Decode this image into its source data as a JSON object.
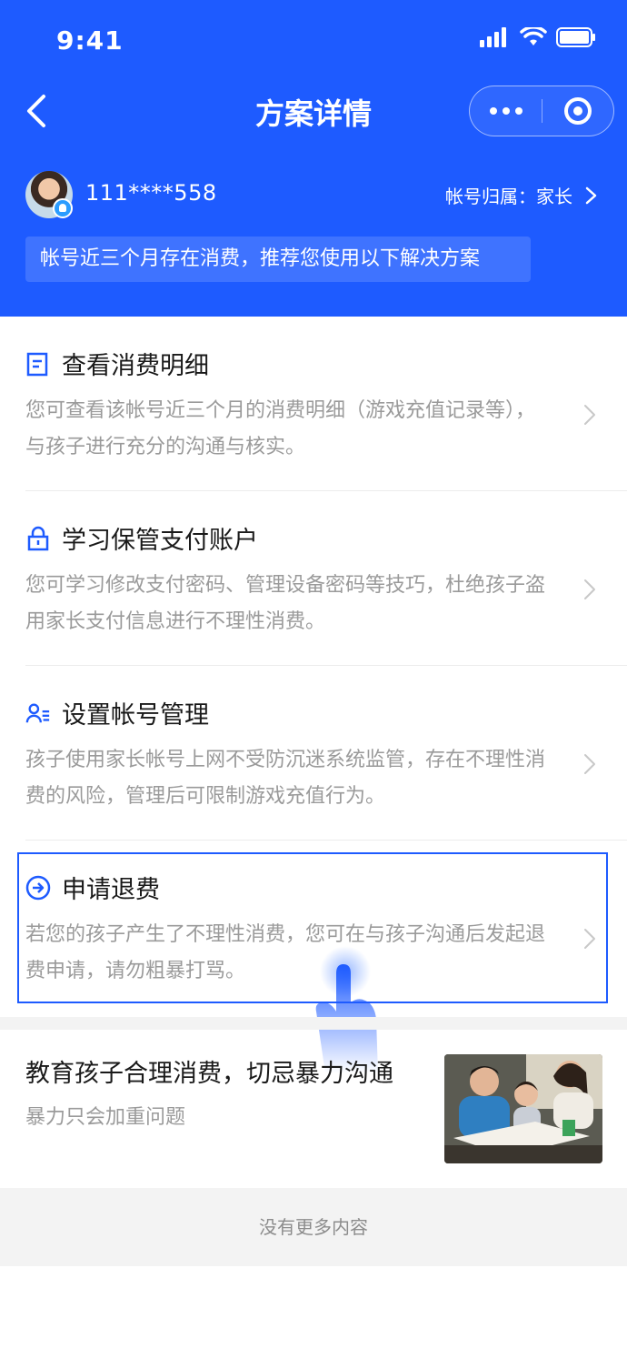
{
  "status": {
    "time": "9:41"
  },
  "nav": {
    "title": "方案详情"
  },
  "account": {
    "id": "111****558",
    "owner_label": "帐号归属：家长"
  },
  "notice": "帐号近三个月存在消费，推荐您使用以下解决方案",
  "options": [
    {
      "title": "查看消费明细",
      "desc": "您可查看该帐号近三个月的消费明细（游戏充值记录等），与孩子进行充分的沟通与核实。",
      "icon": "document-icon"
    },
    {
      "title": "学习保管支付账户",
      "desc": "您可学习修改支付密码、管理设备密码等技巧，杜绝孩子盗用家长支付信息进行不理性消费。",
      "icon": "lock-icon"
    },
    {
      "title": "设置帐号管理",
      "desc": "孩子使用家长帐号上网不受防沉迷系统监管，存在不理性消费的风险，管理后可限制游戏充值行为。",
      "icon": "user-settings-icon"
    },
    {
      "title": "申请退费",
      "desc": "若您的孩子产生了不理性消费，您可在与孩子沟通后发起退费申请，请勿粗暴打骂。",
      "icon": "arrow-circle-icon"
    }
  ],
  "article": {
    "title": "教育孩子合理消费，切忌暴力沟通",
    "subtitle": "暴力只会加重问题"
  },
  "footer": "没有更多内容",
  "colors": {
    "brand": "#1e5bff",
    "muted": "#9a9a9a"
  }
}
